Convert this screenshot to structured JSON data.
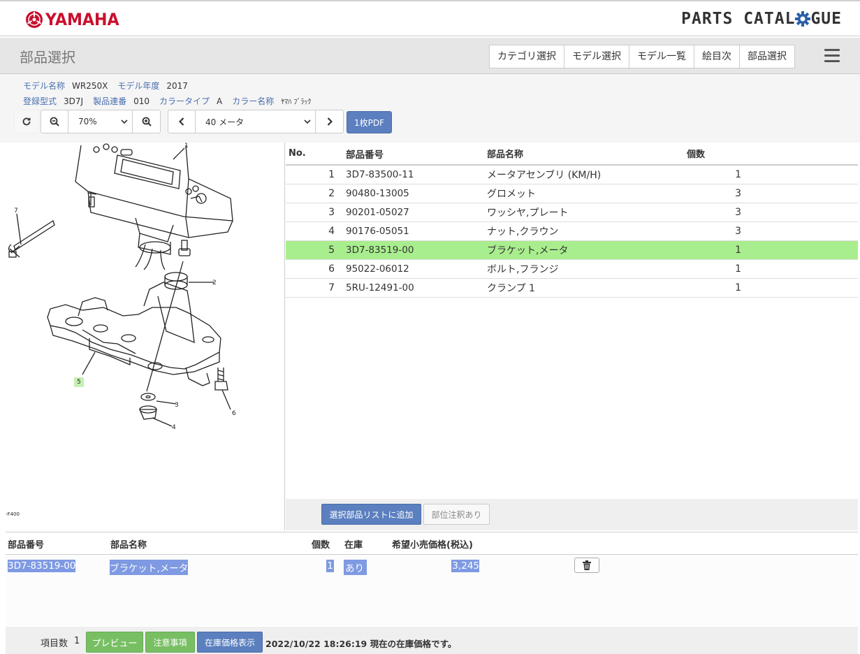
{
  "brand": {
    "name": "YAMAHA",
    "catalogue_a": "PARTS CATAL",
    "catalogue_b": "GUE"
  },
  "page_title": "部品選択",
  "nav": [
    "カテゴリ選択",
    "モデル選択",
    "モデル一覧",
    "絵目次",
    "部品選択"
  ],
  "model": {
    "name_label": "モデル名称",
    "name": "WR250X",
    "year_label": "モデル年度",
    "year": "2017",
    "type_label": "登録型式",
    "type": "3D7J",
    "serial_label": "製品連番",
    "serial": "010",
    "color_type_label": "カラータイプ",
    "color_type": "A",
    "color_name_label": "カラー名称",
    "color_name": "ﾔﾏﾊ ﾌﾞﾗｯｸ"
  },
  "toolbar": {
    "zoom": "70%",
    "figure": "40 メータ",
    "pdf_label": "1枚PDF"
  },
  "diagram": {
    "code": "-F400",
    "callouts": [
      "1",
      "2",
      "3",
      "4",
      "5",
      "6",
      "7"
    ]
  },
  "parts_table": {
    "headers": [
      "No.",
      "部品番号",
      "部品名称",
      "個数"
    ],
    "rows": [
      {
        "no": "1",
        "part_no": "3D7-83500-11",
        "name": "メータアセンブリ (KM/H)",
        "qty": "1"
      },
      {
        "no": "2",
        "part_no": "90480-13005",
        "name": "グロメット",
        "qty": "3"
      },
      {
        "no": "3",
        "part_no": "90201-05027",
        "name": "ワッシヤ,プレート",
        "qty": "3"
      },
      {
        "no": "4",
        "part_no": "90176-05051",
        "name": "ナット,クラウン",
        "qty": "3"
      },
      {
        "no": "5",
        "part_no": "3D7-83519-00",
        "name": "ブラケット,メータ",
        "qty": "1"
      },
      {
        "no": "6",
        "part_no": "95022-06012",
        "name": "ボルト,フランジ",
        "qty": "1"
      },
      {
        "no": "7",
        "part_no": "5RU-12491-00",
        "name": "クランプ 1",
        "qty": "1"
      }
    ],
    "selected_row": 5
  },
  "actions": {
    "add_label": "選択部品リストに追加",
    "note_label": "部位注釈あり"
  },
  "selected_list": {
    "headers": {
      "part_no": "部品番号",
      "name": "部品名称",
      "qty": "個数",
      "stock": "在庫",
      "price": "希望小売価格(税込)"
    },
    "rows": [
      {
        "part_no": "3D7-83519-00",
        "name": "ブラケット,メータ",
        "qty": "1",
        "stock": "あり",
        "price": "3,245"
      }
    ]
  },
  "footer": {
    "count_label": "項目数",
    "count": "1",
    "preview_label": "プレビュー",
    "notes_label": "注意事項",
    "stock_label": "在庫価格表示",
    "status": "2022/10/22 18:26:19 現在の在庫価格です。"
  }
}
